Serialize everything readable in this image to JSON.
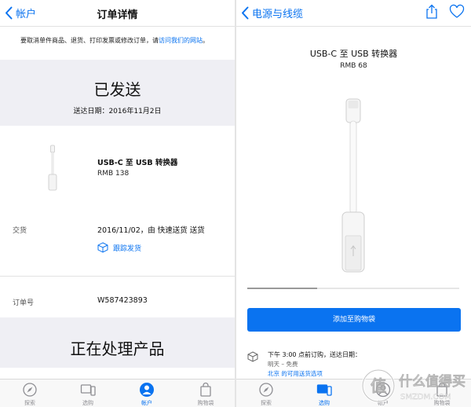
{
  "colors": {
    "accent": "#0a73f0",
    "band": "#efeff4",
    "tab_inactive": "#8e8e93"
  },
  "left": {
    "nav": {
      "back_label": "帐户",
      "title": "订单详情"
    },
    "notice": {
      "text": "要取消单件商品、退货、打印发票或修改订单，请",
      "link": "访问我们的网站",
      "end": "。"
    },
    "status": {
      "title": "已发送",
      "delivery": "送达日期：2016年11月2日"
    },
    "product": {
      "name": "USB-C 至 USB 转换器",
      "price": "RMB 138"
    },
    "shipping": {
      "label": "交货",
      "value": "2016/11/02，由 快速送货 送货",
      "track_label": "跟踪发货"
    },
    "order": {
      "label": "订单号",
      "value": "W587423893"
    },
    "processing": {
      "title": "正在处理产品"
    },
    "tabs": [
      {
        "label": "探索",
        "icon": "compass-icon"
      },
      {
        "label": "选购",
        "icon": "devices-icon"
      },
      {
        "label": "帐户",
        "icon": "person-icon",
        "active": true
      },
      {
        "label": "购物袋",
        "icon": "bag-icon"
      }
    ]
  },
  "right": {
    "nav": {
      "back_label": "电源与线缆"
    },
    "product": {
      "name": "USB-C 至 USB 转换器",
      "price": "RMB 68"
    },
    "gallery": {
      "progress": 0.33
    },
    "add_to_bag": "添加至购物袋",
    "shipping": {
      "line1": "下午 3:00 点前订购，送达日期：",
      "line2": "明天 – 免费",
      "line3": "北京 的可用送货选项"
    },
    "tabs": [
      {
        "label": "探索",
        "icon": "compass-icon"
      },
      {
        "label": "选购",
        "icon": "devices-icon",
        "active": true
      },
      {
        "label": "帐户",
        "icon": "person-icon"
      },
      {
        "label": "购物袋",
        "icon": "bag-icon"
      }
    ]
  },
  "watermark": {
    "title": "什么值得买",
    "subtitle": "SMZDM.COM"
  }
}
